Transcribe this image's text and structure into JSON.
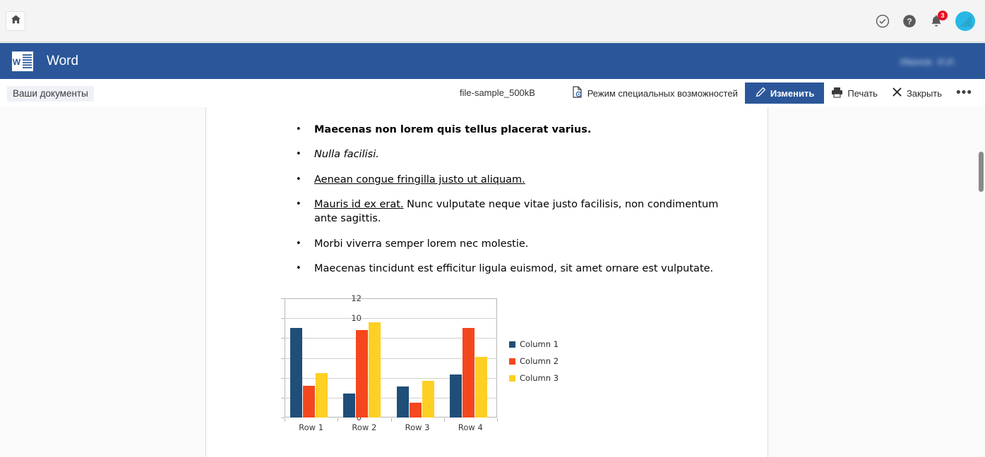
{
  "topbar": {
    "home_icon": "home-icon",
    "icons": [
      {
        "name": "check-circle-icon",
        "label": "Состояние"
      },
      {
        "name": "help-icon",
        "label": "Справка"
      },
      {
        "name": "bell-icon",
        "label": "Уведомления"
      }
    ],
    "notification_count": "3",
    "avatar_label": "avatar"
  },
  "appbar": {
    "title": "Word",
    "logo_letter": "W",
    "user_line1": "Иванов",
    "user_line2": "И.И."
  },
  "commandbar": {
    "documents_tab": "Ваши документы",
    "file_name": "file-sample_500kB",
    "accessibility_label": "Режим специальных возможностей",
    "edit_label": "Изменить",
    "print_label": "Печать",
    "close_label": "Закрыть",
    "more_label": "•••"
  },
  "document": {
    "cut_line_hint": ". . .",
    "paragraphs": [
      {
        "style": "bold",
        "text": "Maecenas non lorem quis tellus placerat varius."
      },
      {
        "style": "italic",
        "text": "Nulla facilisi."
      },
      {
        "style": "underline",
        "text": "Aenean congue fringilla justo ut aliquam."
      },
      {
        "style": "mixed",
        "lead": "Mauris id ex erat.",
        "text": " Nunc vulputate neque vitae justo facilisis, non condimentum ante sagittis."
      },
      {
        "style": "plain",
        "text": "Morbi viverra semper lorem nec molestie."
      },
      {
        "style": "plain",
        "text": "Maecenas tincidunt est efficitur ligula euismod, sit amet ornare est vulputate."
      }
    ]
  },
  "chart_data": {
    "type": "bar",
    "title": "",
    "xlabel": "",
    "ylabel": "",
    "categories": [
      "Row 1",
      "Row 2",
      "Row 3",
      "Row 4"
    ],
    "series": [
      {
        "name": "Column 1",
        "color": "#1F4E79",
        "values": [
          9.05,
          2.4,
          3.1,
          4.3
        ]
      },
      {
        "name": "Column 2",
        "color": "#F4471E",
        "values": [
          3.2,
          8.8,
          1.5,
          9.0
        ]
      },
      {
        "name": "Column 3",
        "color": "#FDD023",
        "values": [
          4.5,
          9.6,
          3.7,
          6.1
        ]
      }
    ],
    "ylim": [
      0,
      12
    ],
    "yticks": [
      0,
      2,
      4,
      6,
      8,
      10,
      12
    ],
    "grid": true,
    "legend_position": "right"
  },
  "scrollbar": {
    "label": "vertical-scrollbar"
  }
}
